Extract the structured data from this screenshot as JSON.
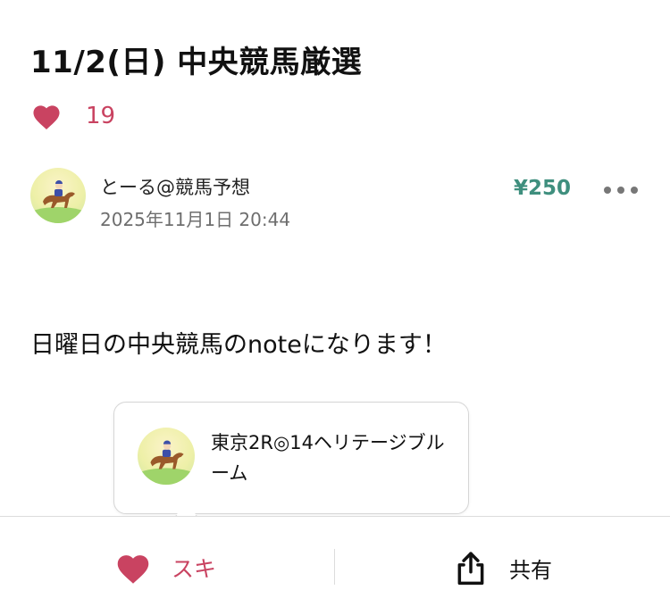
{
  "article": {
    "title": "11/2(日) 中央競馬厳選",
    "like_count": "19",
    "body_text": "日曜日の中央競馬のnoteになります！"
  },
  "author": {
    "name": "とーる@競馬予想",
    "date": "2025年11月1日 20:44",
    "avatar_icon": "horse-racing-avatar"
  },
  "price": "¥250",
  "menu": {
    "icon": "more-icon"
  },
  "bubble": {
    "text": "東京2R◎14ヘリテージブルーム",
    "avatar_icon": "horse-racing-avatar"
  },
  "bottom_bar": {
    "like_label": "スキ",
    "share_label": "共有"
  },
  "colors": {
    "accent_like": "#c94361",
    "price": "#3f8f7e",
    "muted_text": "#6e6e6e"
  }
}
